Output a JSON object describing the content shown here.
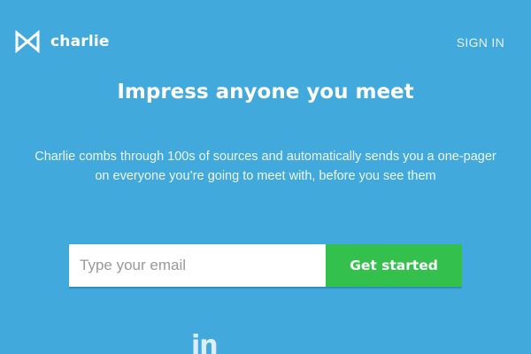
{
  "brand": {
    "name": "charlie",
    "icon": "bowtie-logo-icon"
  },
  "nav": {
    "sign_in_label": "SIGN IN"
  },
  "hero": {
    "headline": "Impress anyone you meet",
    "subhead": "Charlie combs through 100s of sources and automatically sends you a one-pager on everyone you’re going to meet with, before you see them"
  },
  "signup": {
    "email_placeholder": "Type your email",
    "email_value": "",
    "button_label": "Get started"
  },
  "logos": {
    "linkedin_text": "in",
    "linkedin_icon": "linkedin-icon"
  },
  "colors": {
    "background": "#41a9db",
    "cta": "#33c04d",
    "text": "#ffffff"
  }
}
